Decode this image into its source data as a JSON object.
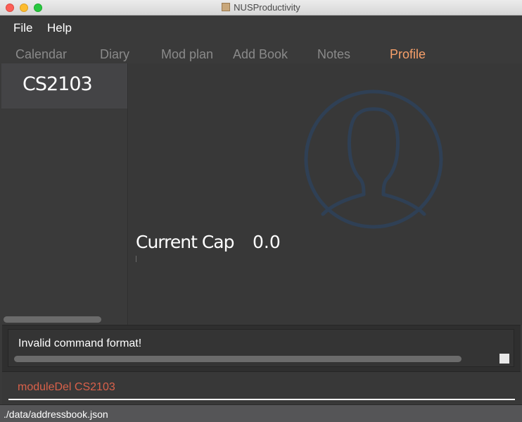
{
  "window": {
    "title": "NUSProductivity"
  },
  "menu": {
    "file": "File",
    "help": "Help"
  },
  "tabs": [
    {
      "label": "Calendar",
      "active": false
    },
    {
      "label": "Diary",
      "active": false
    },
    {
      "label": "Mod plan",
      "active": false
    },
    {
      "label": "Add Book",
      "active": false
    },
    {
      "label": "Notes",
      "active": false
    },
    {
      "label": "Profile",
      "active": true
    }
  ],
  "sidebar": {
    "items": [
      {
        "label": "CS2103"
      }
    ]
  },
  "profile": {
    "icon": "user-silhouette-icon",
    "cap_label": "Current Cap",
    "cap_value": "0.0"
  },
  "result": {
    "message": "Invalid command format!"
  },
  "command": {
    "value": "moduleDel CS2103"
  },
  "status": {
    "path": "./data/addressbook.json"
  },
  "colors": {
    "accent_tab": "#f7a06a",
    "command_text": "#d9614a",
    "icon_stroke": "#2f4055"
  }
}
